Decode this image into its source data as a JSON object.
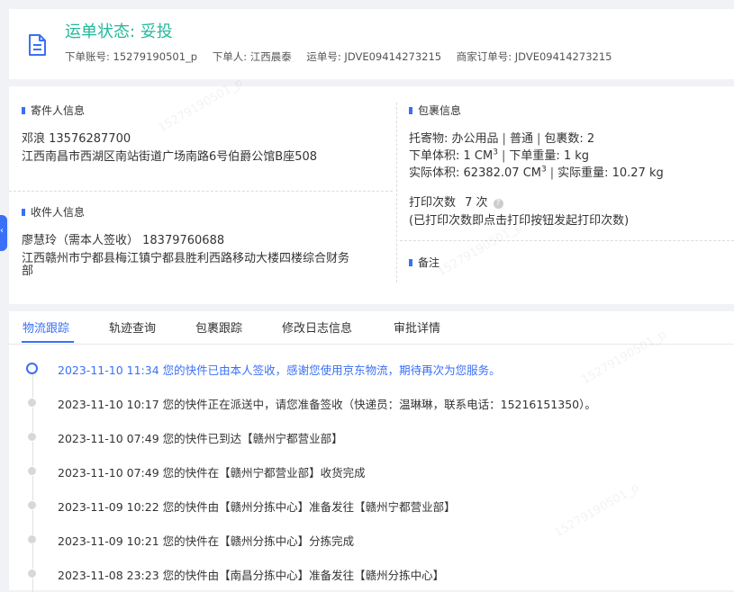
{
  "header": {
    "status_title": "运单状态: 妥投",
    "order_account": "下单账号: 15279190501_p",
    "orderer": "下单人: 江西晨泰",
    "waybill_no": "运单号: JDVE09414273215",
    "merchant_order_no": "商家订单号: JDVE09414273215",
    "icon": "document-icon"
  },
  "sender": {
    "title": "寄件人信息",
    "name_phone": "邓浪   13576287700",
    "address": "江西南昌市西湖区南站街道广场南路6号伯爵公馆B座508"
  },
  "receiver": {
    "title": "收件人信息",
    "name_phone": "廖慧玲（需本人签收）  18379760688",
    "address_line1": "江西赣州市宁都县梅江镇宁都县胜利西路移动大楼四楼综合财务",
    "address_line2": "部"
  },
  "package": {
    "title": "包裹信息",
    "goods_label": "托寄物:",
    "goods_value": "办公用品",
    "service": "普通",
    "count": "包裹数:  2",
    "order_volume_label": "下单体积:",
    "order_volume_value": "1 CM",
    "order_weight": "下单重量:  1 kg",
    "actual_volume_label": "实际体积:",
    "actual_volume_value": "62382.07 CM",
    "actual_weight": "实际重量:  10.27 kg",
    "volume_unit_exp": "3",
    "print_count_label": "打印次数",
    "print_count_value": "7 次",
    "print_note": "(已打印次数即点击打印按钮发起打印次数)",
    "separator": "|"
  },
  "remark": {
    "title": "备注"
  },
  "side_tab": {
    "arrow": "‹"
  },
  "tabs": [
    "物流跟踪",
    "轨迹查询",
    "包裹跟踪",
    "修改日志信息",
    "审批详情"
  ],
  "events": [
    "2023-11-10 11:34 您的快件已由本人签收，感谢您使用京东物流，期待再次为您服务。",
    "2023-11-10 10:17 您的快件正在派送中，请您准备签收（快递员：温琳琳，联系电话：15216151350）。",
    "2023-11-10 07:49 您的快件已到达【赣州宁都营业部】",
    "2023-11-10 07:49 您的快件在【赣州宁都营业部】收货完成",
    "2023-11-09 10:22 您的快件由【赣州分拣中心】准备发往【赣州宁都营业部】",
    "2023-11-09 10:21 您的快件在【赣州分拣中心】分拣完成",
    "2023-11-08 23:23 您的快件由【南昌分拣中心】准备发往【赣州分拣中心】"
  ],
  "watermark": "15279190501_p",
  "colors": {
    "accent": "#3a6ff7",
    "status": "#23b99a"
  }
}
